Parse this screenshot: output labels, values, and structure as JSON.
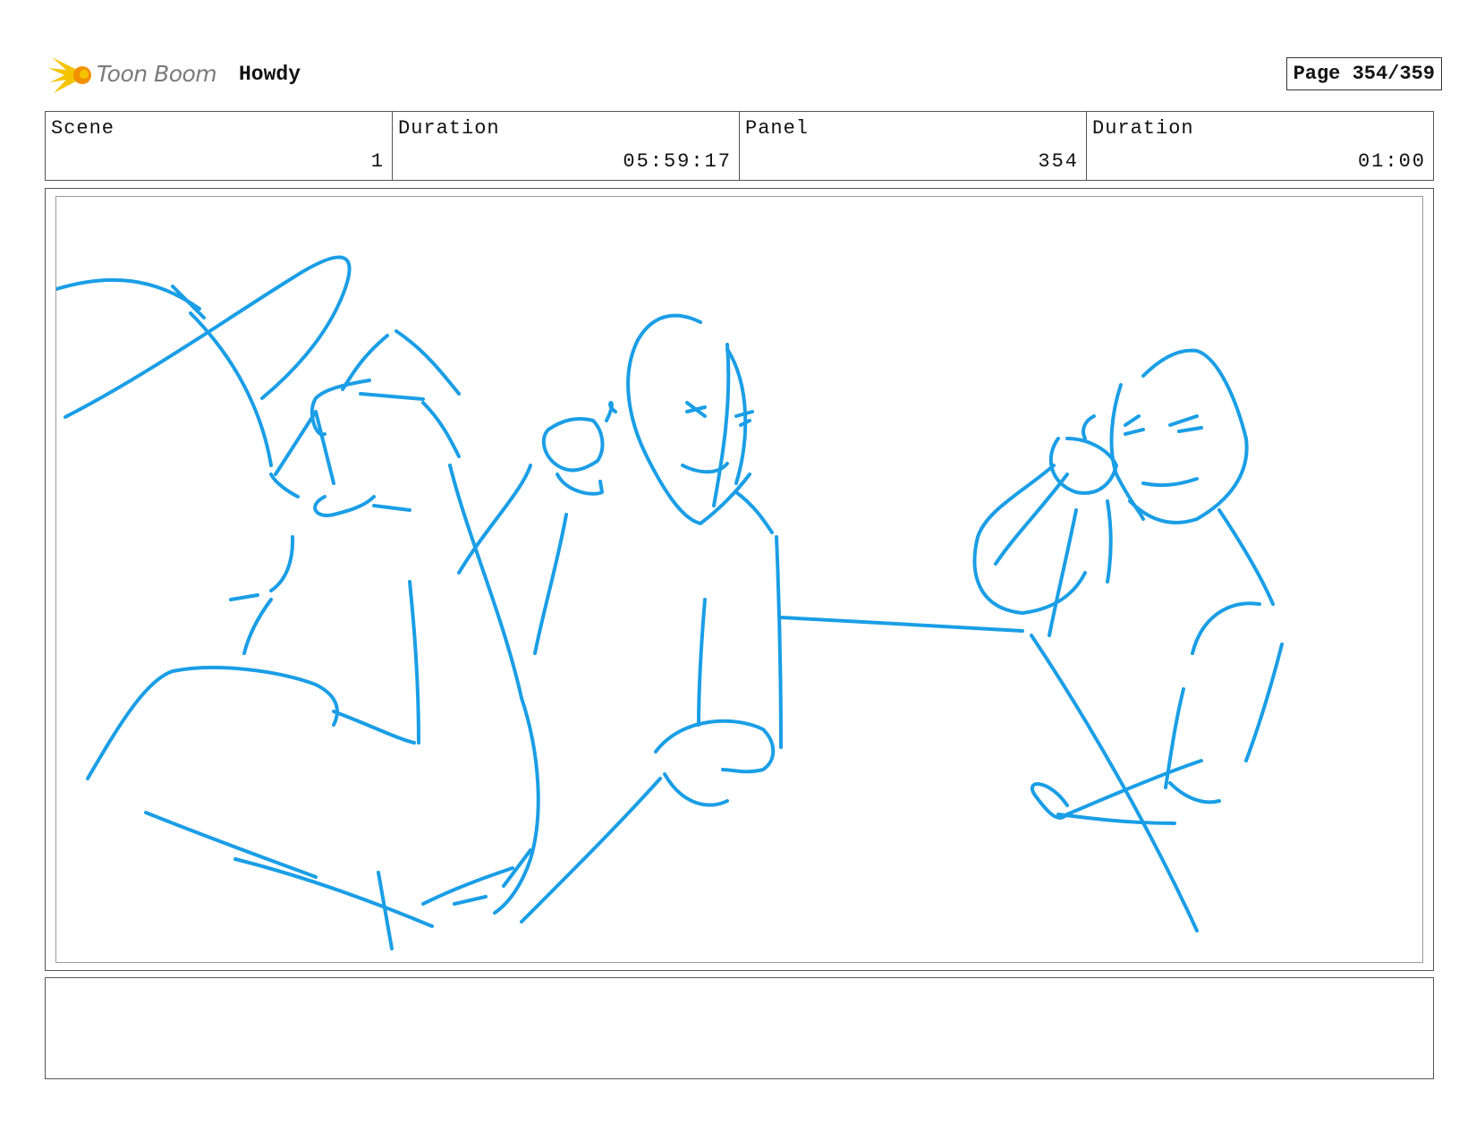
{
  "header": {
    "logo_text": "Toon Boom",
    "project_title": "Howdy",
    "page_indicator": "Page 354/359"
  },
  "info": {
    "scene_label": "Scene",
    "scene_value": "1",
    "scene_duration_label": "Duration",
    "scene_duration_value": "05:59:17",
    "panel_label": "Panel",
    "panel_value": "354",
    "panel_duration_label": "Duration",
    "panel_duration_value": "01:00"
  },
  "colors": {
    "sketch_stroke": "#1a9ee6",
    "logo_yellow": "#f5c400",
    "logo_orange": "#f29100"
  },
  "icons": {
    "logo": "toon-boom-burst-icon"
  },
  "notes": ""
}
